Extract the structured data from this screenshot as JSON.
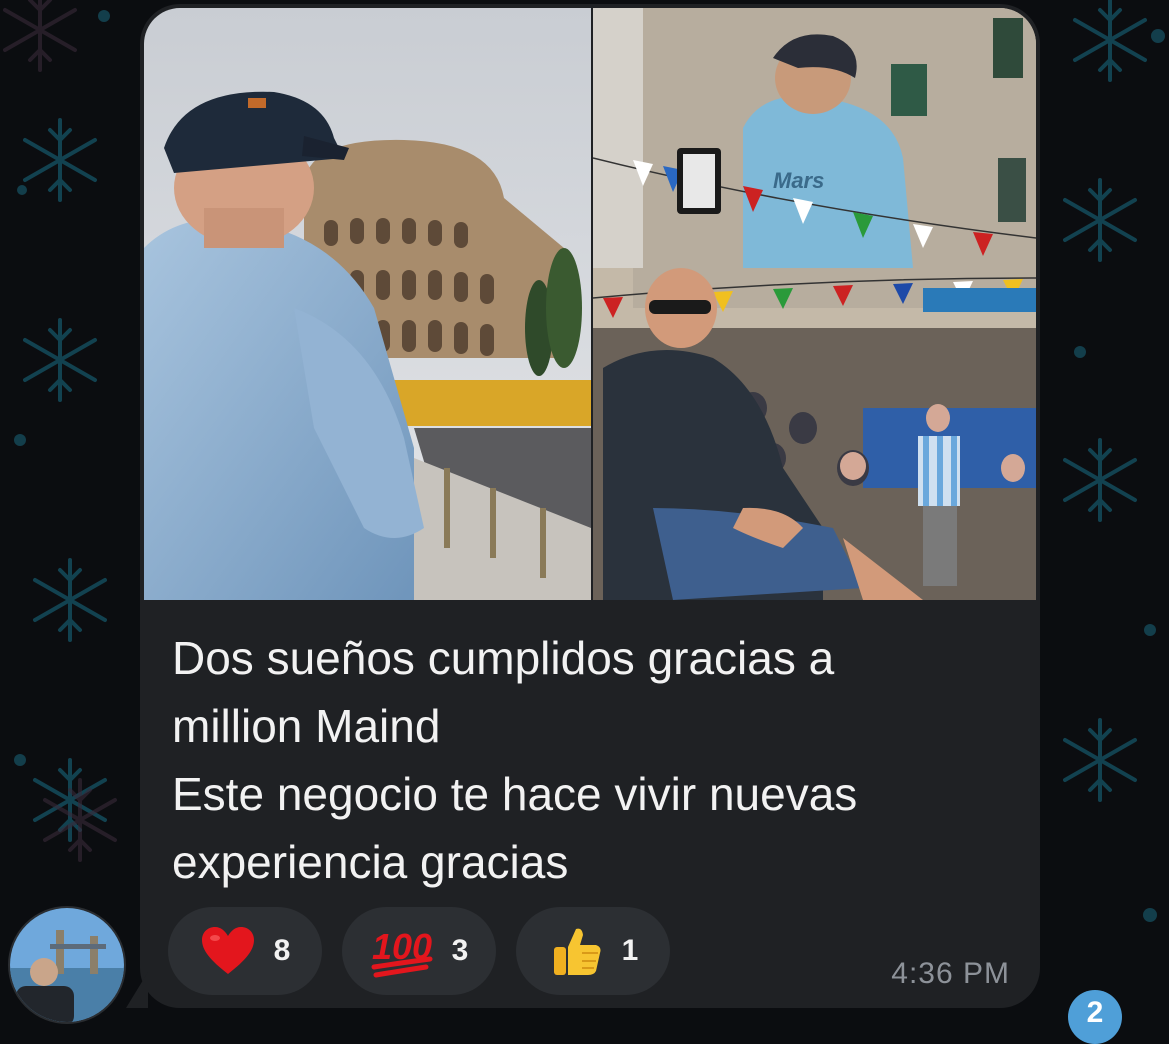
{
  "message": {
    "caption_lines": [
      "Dos sueños cumplidos gracias a",
      "million Maind",
      "Este negocio te hace vivir nuevas",
      "experiencia gracias"
    ],
    "time": "4:36 PM",
    "photos": [
      {
        "subject": "man-at-colosseum"
      },
      {
        "subject": "man-at-maradona-mural"
      }
    ],
    "reactions": [
      {
        "icon": "heart-icon",
        "emoji": "❤️",
        "count": "8"
      },
      {
        "icon": "hundred-points-icon",
        "emoji": "💯",
        "count": "3"
      },
      {
        "icon": "thumbs-up-icon",
        "emoji": "👍",
        "count": "1"
      }
    ]
  },
  "sender": {
    "avatar_icon": "sender-avatar"
  },
  "unread_badge": {
    "count": "2"
  },
  "colors": {
    "bubble": "#1f2124",
    "reaction_pill": "#2c2f33",
    "text": "#f2f2f2",
    "time": "#8d9299",
    "badge": "#4f9fd8",
    "wallpaper_pattern": "#1b6f86"
  }
}
